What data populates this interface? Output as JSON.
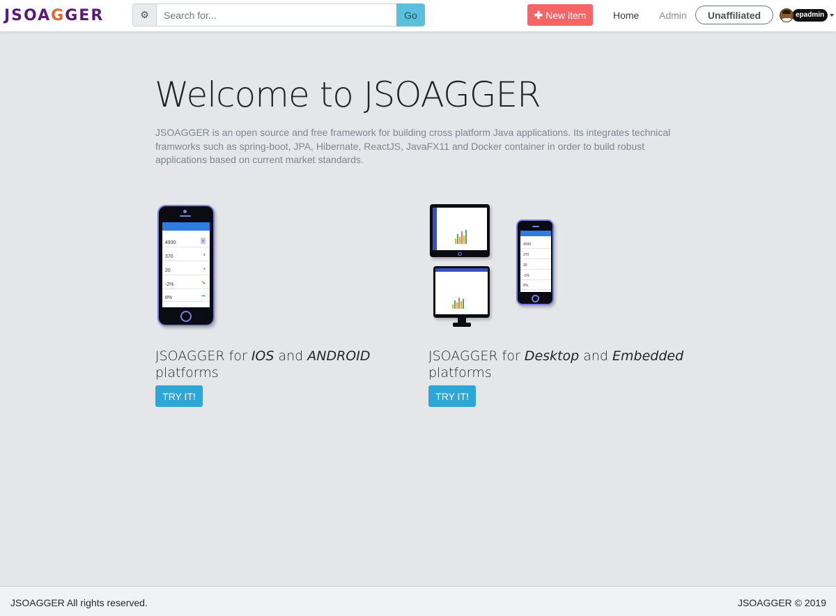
{
  "header": {
    "logo_text": "JSOAGGER",
    "search": {
      "placeholder": "Search for...",
      "value": "",
      "go_label": "Go"
    },
    "new_item_label": "New item",
    "nav": {
      "home": "Home",
      "admin": "Admin"
    },
    "affiliation_label": "Unaffiliated",
    "username": "epadmin"
  },
  "main": {
    "title": "Welcome to JSOAGGER",
    "intro": "JSOAGGER is an open source and free framework for building cross platform Java applications. Its integrates technical framworks such as spring-boot, JPA, Hibernate, ReactJS, JavaFX11 and Docker container in order to build robust applications based on current market standards.",
    "cards": [
      {
        "title_prefix": "JSOAGGER for ",
        "title_em1": "IOS",
        "title_mid": " and ",
        "title_em2": "ANDROID",
        "title_suffix": " platforms",
        "button_label": "TRY IT!",
        "phone_values": [
          "4930",
          "370",
          "20",
          "-2%",
          "8%"
        ]
      },
      {
        "title_prefix": "JSOAGGER for ",
        "title_em1": "Desktop",
        "title_mid": " and ",
        "title_em2": "Embedded",
        "title_suffix": " platforms",
        "button_label": "TRY IT!",
        "phone_values": [
          "4930",
          "370",
          "20",
          "-2%",
          "8%"
        ]
      }
    ]
  },
  "footer": {
    "left": "JSOAGGER All rights reserved.",
    "right": "JSOAGGER © 2019"
  },
  "colors": {
    "brand_purple": "#5b1a78",
    "brand_orange": "#e0662d",
    "new_item": "#f56565",
    "go_button": "#5bc0de",
    "try_button": "#2ea6d6",
    "device_frame": "#7b7fe0"
  }
}
